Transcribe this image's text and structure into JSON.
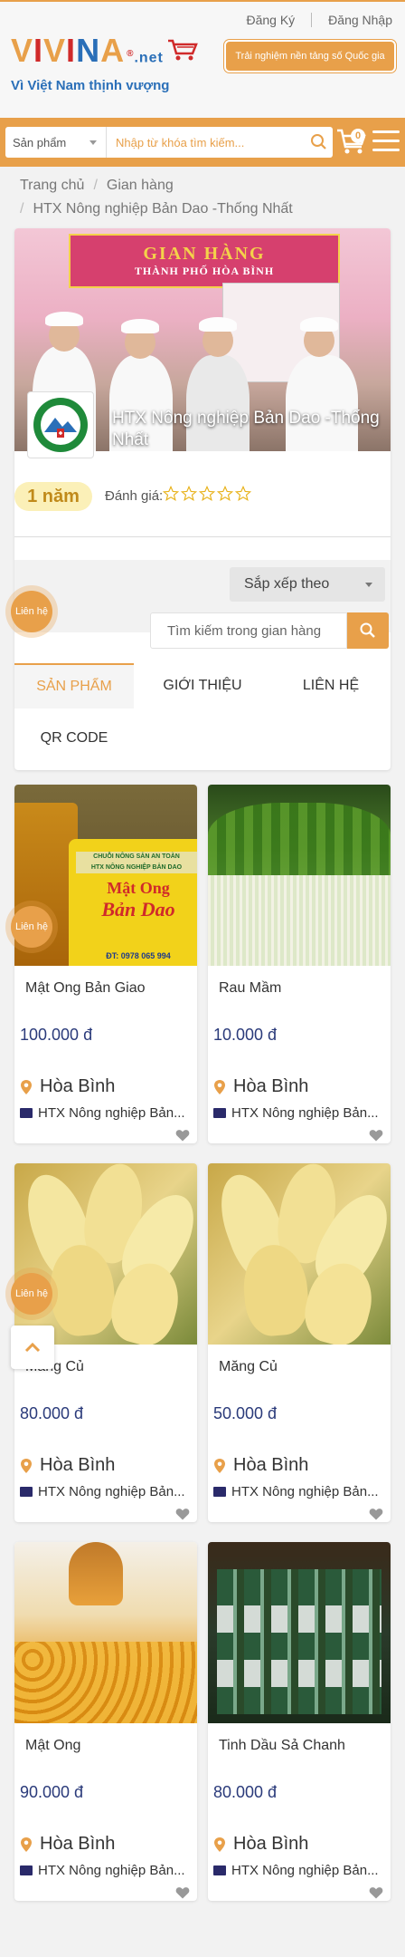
{
  "header": {
    "register": "Đăng Ký",
    "login": "Đăng Nhập",
    "logo_letters": [
      "V",
      "I",
      "V",
      "I",
      "N",
      "A"
    ],
    "logo_net": ".net",
    "logo_registered": "®",
    "slogan": "Vì Việt Nam thịnh vượng",
    "cta": "Trải nghiệm nền tảng số Quốc gia"
  },
  "search": {
    "category": "Sản phẩm",
    "placeholder": "Nhập từ khóa tìm kiếm...",
    "cart_count": "0"
  },
  "breadcrumb": {
    "home": "Trang chủ",
    "section": "Gian hàng",
    "current": "HTX Nông nghiệp Bản Dao -Thống Nhất"
  },
  "shop": {
    "banner_title": "GIAN HÀNG",
    "banner_subtitle": "THÀNH PHỐ HÒA BÌNH",
    "name": "HTX Nông nghiệp Bản Dao -Thống Nhất",
    "years": "1 năm",
    "rating_label": "Đánh giá:",
    "rating": 0,
    "sort": "Sắp xếp theo",
    "search_placeholder": "Tìm kiếm trong gian hàng",
    "tabs": [
      "SẢN PHẨM",
      "GIỚI THIỆU",
      "LIÊN HỆ",
      "QR CODE"
    ]
  },
  "floating": {
    "contact": "Liên hệ"
  },
  "products": [
    {
      "name": "Mật Ong Bản Giao",
      "price": "100.000 đ",
      "location": "Hòa Bình",
      "shop": "HTX Nông nghiệp Bản...",
      "label_line1": "Mật Ong",
      "label_line2": "Bản Dao",
      "phone": "ĐT: 0978 065 994"
    },
    {
      "name": "Rau Mầm",
      "price": "10.000 đ",
      "location": "Hòa Bình",
      "shop": "HTX Nông nghiệp Bản..."
    },
    {
      "name": "Măng Củ",
      "price": "80.000 đ",
      "location": "Hòa Bình",
      "shop": "HTX Nông nghiệp Bản..."
    },
    {
      "name": "Măng Củ",
      "price": "50.000 đ",
      "location": "Hòa Bình",
      "shop": "HTX Nông nghiệp Bản..."
    },
    {
      "name": "Mật Ong",
      "price": "90.000 đ",
      "location": "Hòa Bình",
      "shop": "HTX Nông nghiệp Bản..."
    },
    {
      "name": "Tinh Dầu Sả Chanh",
      "price": "80.000 đ",
      "location": "Hòa Bình",
      "shop": "HTX Nông nghiệp Bản..."
    }
  ],
  "colors": {
    "accent": "#e8a04a",
    "brand_blue": "#2a6fb8",
    "price": "#2a3a7a"
  }
}
